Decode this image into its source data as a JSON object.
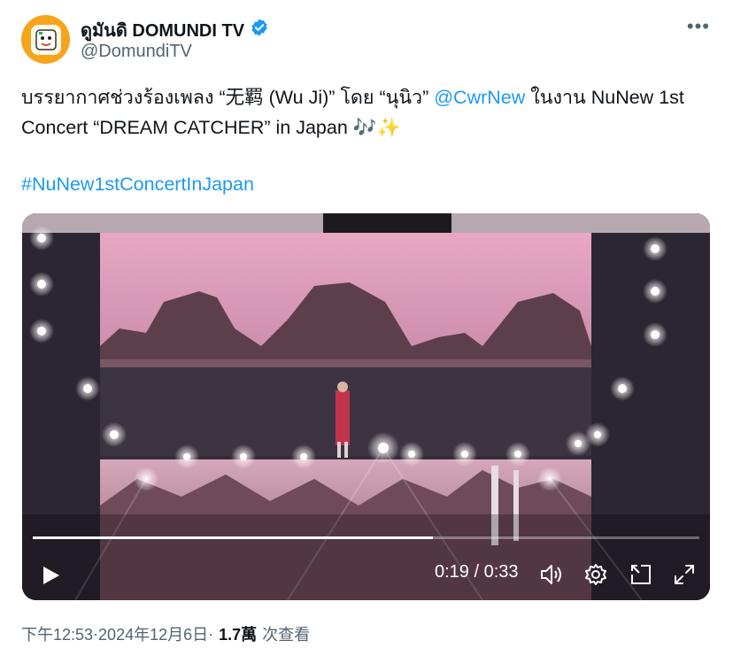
{
  "account": {
    "display_name": "ดูมันดิ DOMUNDI TV",
    "handle": "@DomundiTV",
    "verified_color": "#1d9bf0",
    "avatar_color": "#f7a41d"
  },
  "tweet": {
    "text_part1": "บรรยากาศช่วงร้องเพลง “无羁 (Wu Ji)” โดย “นุนิว” ",
    "mention": "@CwrNew",
    "text_part2": " ในงาน NuNew 1st Concert “DREAM CATCHER” in Japan 🎶✨",
    "hashtag": "#NuNew1stConcertInJapan"
  },
  "video": {
    "current_time": "0:19",
    "duration": "0:33",
    "time_separator": " / ",
    "progress": 0.6
  },
  "meta": {
    "time": "下午12:53",
    "separator": " · ",
    "date": "2024年12月6日",
    "separator2": " · ",
    "views_count": "1.7萬",
    "views_label": "次查看"
  },
  "icons": {
    "more": "more-icon",
    "verified": "verified-badge-icon",
    "play": "play-icon",
    "volume": "volume-icon",
    "settings": "gear-icon",
    "pip": "picture-in-picture-icon",
    "fullscreen": "fullscreen-icon"
  }
}
